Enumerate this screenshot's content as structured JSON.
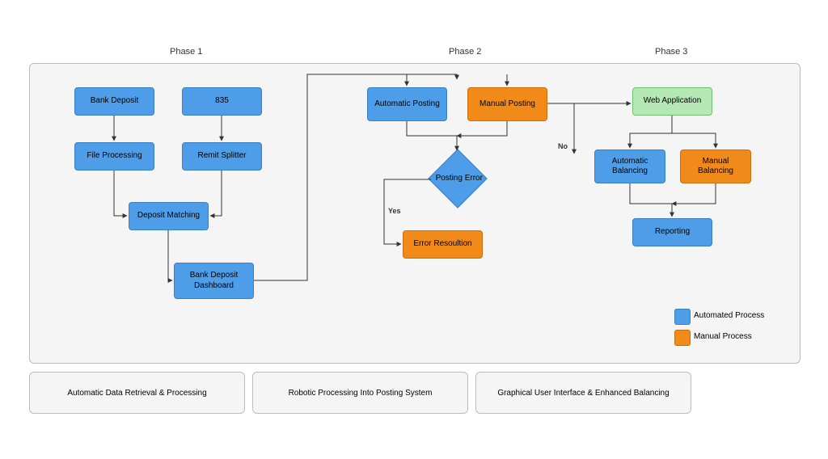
{
  "phases": {
    "p1": "Phase 1",
    "p2": "Phase 2",
    "p3": "Phase 3"
  },
  "nodes": {
    "bank_deposit": "Bank Deposit",
    "n835": "835",
    "file_processing": "File Processing",
    "remit_splitter": "Remit Splitter",
    "deposit_matching": "Deposit Matching",
    "dashboard": "Bank Deposit Dashboard",
    "auto_posting": "Automatic Posting",
    "manual_posting": "Manual Posting",
    "posting_error": "Posting Error",
    "error_res": "Error Resoultion",
    "web_app": "Web Application",
    "auto_bal": "Automatic Balancing",
    "manual_bal": "Manual Balancing",
    "reporting": "Reporting"
  },
  "edges": {
    "yes": "Yes",
    "no": "No"
  },
  "legend": {
    "auto": "Automated Process",
    "manual": "Manual Process"
  },
  "footers": {
    "f1": "Automatic Data Retrieval & Processing",
    "f2": "Robotic Processing Into Posting System",
    "f3": "Graphical User Interface & Enhanced Balancing"
  },
  "colors": {
    "blue": "#4d9de8",
    "orange": "#f28a1a",
    "green": "#b6e8b6"
  }
}
